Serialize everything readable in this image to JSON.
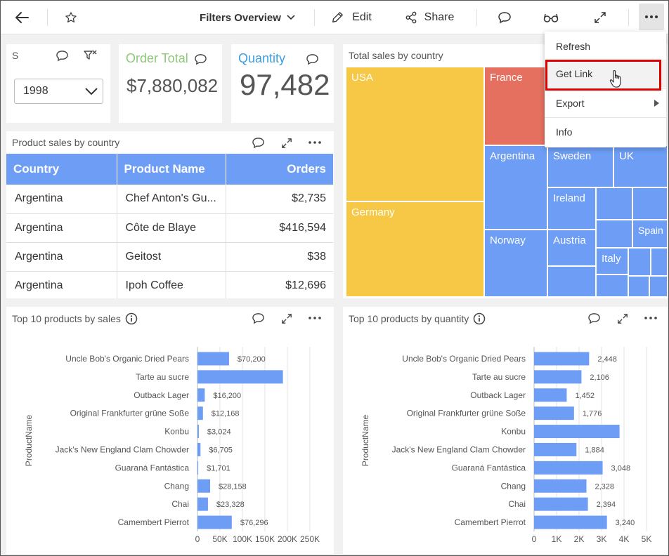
{
  "toolbar": {
    "title": "Filters Overview",
    "edit_label": "Edit",
    "share_label": "Share"
  },
  "filter_card": {
    "title_fragment": "S",
    "year_value": "1998"
  },
  "kpi_order_total": {
    "label": "Order Total",
    "value": "$7,880,082",
    "label_color": "#8fc87a"
  },
  "kpi_quantity": {
    "label": "Quantity",
    "value": "97,482",
    "label_color": "#3a9ee0"
  },
  "product_sales": {
    "title": "Product sales by country",
    "columns": [
      "Country",
      "Product Name",
      "Orders"
    ],
    "rows": [
      [
        "Argentina",
        "Chef Anton's Gu...",
        "$2,735"
      ],
      [
        "Argentina",
        "Côte de Blaye",
        "$416,594"
      ],
      [
        "Argentina",
        "Geitost",
        "$38"
      ],
      [
        "Argentina",
        "Ipoh Coffee",
        "$12,696"
      ]
    ]
  },
  "treemap": {
    "title": "Total sales by country",
    "labels": {
      "usa": "USA",
      "germany": "Germany",
      "france": "France",
      "argentina": "Argentina",
      "norway": "Norway",
      "sweden": "Sweden",
      "uk": "UK",
      "ireland": "Ireland",
      "austria": "Austria",
      "spain": "Spain",
      "italy": "Italy"
    },
    "colors": {
      "yellow": "#f7c845",
      "red": "#e57060",
      "blue": "#6d9df4"
    }
  },
  "menu": {
    "items": [
      "Refresh",
      "Get Link",
      "Export",
      "Info"
    ]
  },
  "chart_data": [
    {
      "type": "bar",
      "title": "Top 10 products by sales",
      "ylabel": "ProductName",
      "xlabel": "",
      "categories": [
        "Uncle Bob's Organic Dried Pears",
        "Tarte au sucre",
        "Outback Lager",
        "Original Frankfurter grüne Soße",
        "Konbu",
        "Jack's New England Clam Chowder",
        "Guaraná Fantástica",
        "Chang",
        "Chai",
        "Camembert Pierrot"
      ],
      "values": [
        70200,
        190000,
        16200,
        12168,
        3024,
        6705,
        1701,
        28158,
        23328,
        76296
      ],
      "data_labels": [
        "$70,200",
        "",
        "$16,200",
        "$12,168",
        "$3,024",
        "$6,705",
        "$1,701",
        "$28,158",
        "$23,328",
        "$76,296"
      ],
      "xlim": [
        0,
        250000
      ],
      "xticks": [
        "0",
        "50K",
        "100K",
        "150K",
        "200K",
        "250K"
      ],
      "grid": true,
      "color": "#6d9df4"
    },
    {
      "type": "bar",
      "title": "Top 10 products by quantity",
      "ylabel": "ProductName",
      "xlabel": "",
      "categories": [
        "Uncle Bob's Organic Dried Pears",
        "Tarte au sucre",
        "Outback Lager",
        "Original Frankfurter grüne Soße",
        "Konbu",
        "Jack's New England Clam Chowder",
        "Guaraná Fantástica",
        "Chang",
        "Chai",
        "Camembert Pierrot"
      ],
      "values": [
        2448,
        2106,
        1452,
        1776,
        3800,
        1884,
        3048,
        2328,
        2394,
        3240
      ],
      "data_labels": [
        "2,448",
        "2,106",
        "1,452",
        "1,776",
        "",
        "1,884",
        "3,048",
        "2,328",
        "2,394",
        "3,240"
      ],
      "xlim": [
        0,
        5000
      ],
      "xticks": [
        "0",
        "1K",
        "2K",
        "3K",
        "4K",
        "5K"
      ],
      "grid": true,
      "color": "#6d9df4"
    }
  ]
}
